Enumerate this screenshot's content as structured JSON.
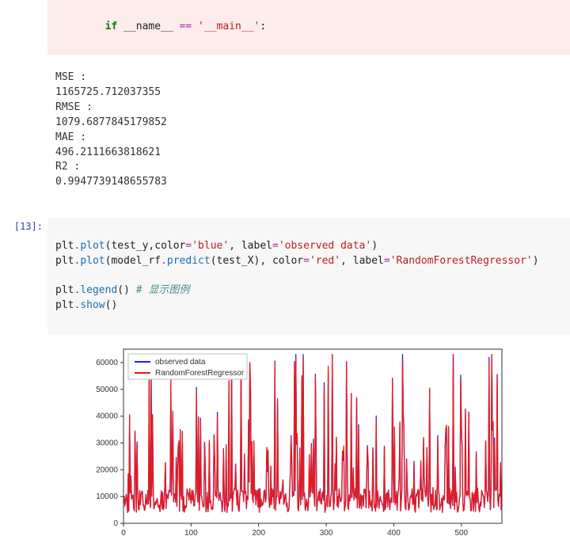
{
  "warn_cell": {
    "code_line": "  if __name__ == '__main__':",
    "stdout_lines": [
      "MSE :",
      "1165725.712037355",
      "RMSE :",
      "1079.6877845179852",
      "MAE :",
      "496.2111663818621",
      "R2 :",
      "0.9947739148655783"
    ]
  },
  "code_cell": {
    "prompt": "[13]:",
    "tokens": {
      "t_plt": "plt",
      "t_dot": ".",
      "t_plot": "plot",
      "t_op": "(",
      "t_cp": ")",
      "t_comma": ",",
      "t_eq": "=",
      "t_testy": "test_y",
      "t_color": "color",
      "t_blue": "'blue'",
      "t_label": "label",
      "t_obs": "'observed data'",
      "t_model": "model_rf",
      "t_predict": "predict",
      "t_testX": "test_X",
      "t_red": "'red'",
      "t_rfr": "'RandomForestRegressor'",
      "t_legend": "legend",
      "t_comment": "# 显示图例",
      "t_show": "show"
    }
  },
  "chart_data": {
    "type": "line",
    "title": "",
    "xlabel": "",
    "ylabel": "",
    "xlim": [
      0,
      560
    ],
    "ylim": [
      0,
      65000
    ],
    "xticks": [
      0,
      100,
      200,
      300,
      400,
      500
    ],
    "yticks": [
      0,
      10000,
      20000,
      30000,
      40000,
      50000,
      60000
    ],
    "legend_position": "upper-left",
    "series": [
      {
        "name": "observed data",
        "color": "#1f1fff"
      },
      {
        "name": "RandomForestRegressor",
        "color": "#e41a1c"
      }
    ],
    "n_points": 560,
    "note": "Two highly-overlapping dense line series (~560 points). Blue = observed data, red = RandomForestRegressor prediction. Values range 0–63000 with most mass 3000–15000 and intermittent spikes to 40000–63000. Individual y-values not readable from image; series rendered procedurally below to match visual character."
  }
}
